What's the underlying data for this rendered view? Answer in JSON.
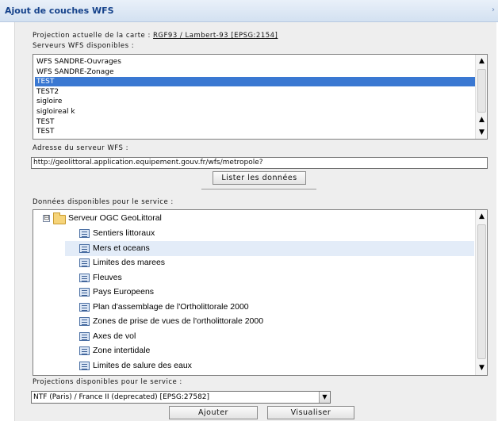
{
  "window": {
    "title": "Ajout de couches WFS",
    "close_glyph": "›"
  },
  "projection": {
    "label": "Projection actuelle de la carte : ",
    "value": "RGF93 / Lambert-93 [EPSG:2154]"
  },
  "servers": {
    "label": "Serveurs WFS disponibles :",
    "items": [
      "WFS SANDRE-Ouvrages",
      "WFS SANDRE-Zonage",
      "TEST",
      "TEST2",
      "sigloire",
      "sigloireal k",
      "TEST",
      "TEST"
    ],
    "selected_index": 2
  },
  "address": {
    "label": "Adresse du serveur WFS :",
    "value": "http://geolittoral.application.equipement.gouv.fr/wfs/metropole?"
  },
  "list_button": "Lister les données",
  "data": {
    "label": "Données disponibles pour le service :",
    "root": "Serveur OGC GeoLittoral",
    "root_expander": "⊟",
    "layers": [
      "Sentiers littoraux",
      "Mers et oceans",
      "Limites des marees",
      "Fleuves",
      "Pays Europeens",
      "Plan d'assemblage de l'Ortholittorale 2000",
      "Zones de prise de vues de l'ortholittorale 2000",
      "Axes de vol",
      "Zone intertidale",
      "Limites de salure des eaux"
    ],
    "highlighted_index": 1
  },
  "projections": {
    "label": "Projections disponibles pour le service :",
    "selected": "NTF (Paris) / France II (deprecated) [EPSG:27582]"
  },
  "buttons": {
    "add": "Ajouter",
    "preview": "Visualiser"
  },
  "icons": {
    "scroll_up": "▲",
    "scroll_down": "▼",
    "dropdown": "▼"
  },
  "colors": {
    "title": "#15428b",
    "selection": "#3a78d2",
    "highlight": "#e3ecf8"
  }
}
